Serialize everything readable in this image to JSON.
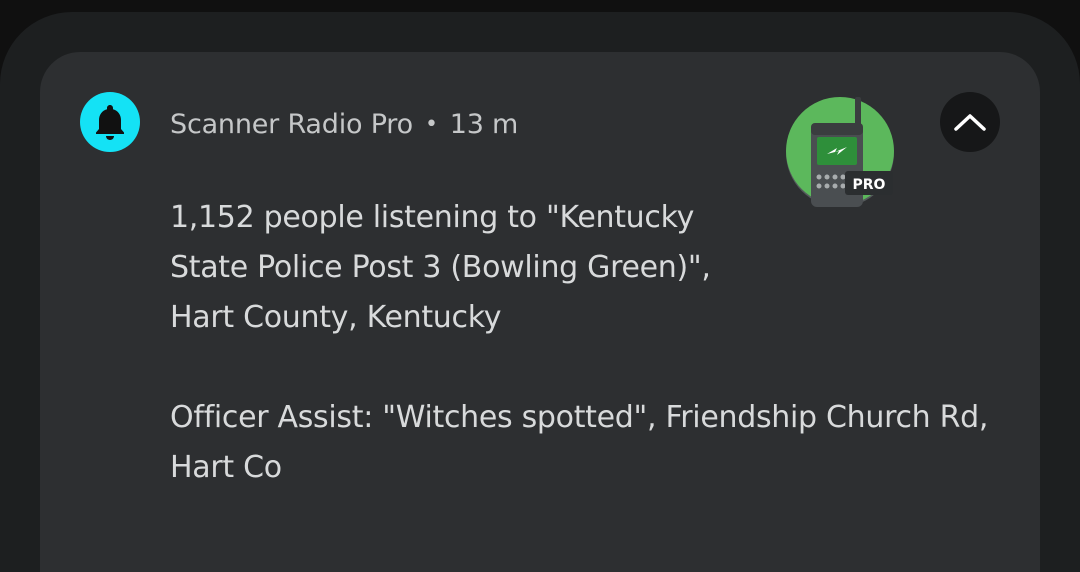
{
  "notification": {
    "app_name": "Scanner Radio Pro",
    "separator": "•",
    "time": "13 m",
    "line1": "1,152 people listening to \"Kentucky State Police Post 3 (Bowling Green)\", Hart County, Kentucky",
    "line2": "Officer Assist: \"Witches spotted\", Friendship Church Rd, Hart Co",
    "badge": "PRO"
  },
  "icons": {
    "app_icon": "bell-icon",
    "large_icon": "scanner-radio-pro-icon",
    "collapse": "chevron-up-icon"
  },
  "colors": {
    "app_icon_bg": "#14e2f5",
    "large_icon_bg": "#5cb85c",
    "card_bg": "#2d2f31",
    "outer_bg": "#1d1f20"
  }
}
